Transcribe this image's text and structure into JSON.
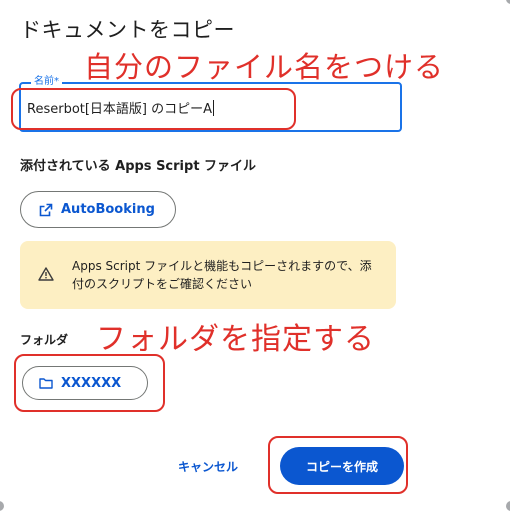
{
  "dialog": {
    "title": "ドキュメントをコピー"
  },
  "annotations": {
    "name_note": "自分のファイル名をつける",
    "folder_note": "フォルダを指定する",
    "highlight_color": "#e0302a"
  },
  "name_field": {
    "label": "名前*",
    "value": "Reserbot[日本語版] のコピーA"
  },
  "apps_script": {
    "heading": "添付されている Apps Script ファイル",
    "file_button": "AutoBooking",
    "file_icon": "open-in-new-icon"
  },
  "warning": {
    "text": "Apps Script ファイルと機能もコピーされますので、添付のスクリプトをご確認ください",
    "icon": "warning-icon",
    "background": "#fdefc3"
  },
  "folder": {
    "label": "フォルダ",
    "button": "XXXXXX",
    "icon": "folder-icon"
  },
  "actions": {
    "cancel": "キャンセル",
    "copy": "コピーを作成"
  },
  "colors": {
    "accent": "#1a73e8",
    "primary_button": "#0b57d0"
  }
}
